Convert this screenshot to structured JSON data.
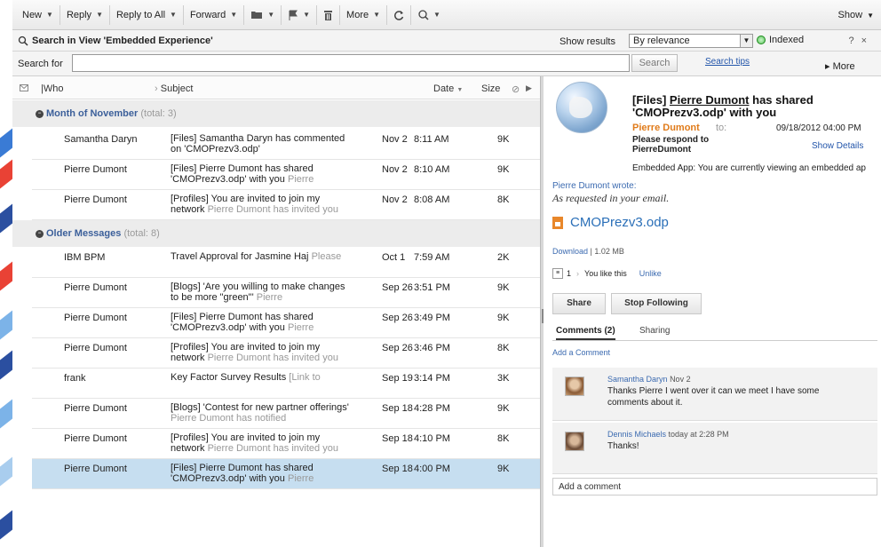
{
  "toolbar": {
    "new": "New",
    "reply": "Reply",
    "reply_all": "Reply to All",
    "forward": "Forward",
    "more": "More",
    "show": "Show"
  },
  "search_header": {
    "title": "Search in View 'Embedded Experience'",
    "show_results_label": "Show results",
    "sort_value": "By relevance",
    "indexed": "Indexed",
    "help": "?",
    "close": "×"
  },
  "search_row": {
    "label": "Search for",
    "value": "",
    "button": "Search",
    "tips": "Search tips",
    "more": "▸ More"
  },
  "columns": {
    "who": "Who",
    "subject": "Subject",
    "date": "Date",
    "size": "Size"
  },
  "groups": [
    {
      "name": "Month of November",
      "total": "(total: 3)"
    },
    {
      "name": "Older Messages",
      "total": "(total: 8)"
    }
  ],
  "messages": [
    {
      "who": "Samantha Daryn",
      "subject": "[Files] Samantha Daryn has commented on 'CMOPrezv3.odp'",
      "snippet": "",
      "date": "Nov 2",
      "time": "8:11 AM",
      "size": "9K"
    },
    {
      "who": "Pierre Dumont",
      "subject": "[Files] Pierre Dumont has shared 'CMOPrezv3.odp' with you",
      "snippet": "Pierre",
      "date": "Nov 2",
      "time": "8:10 AM",
      "size": "9K"
    },
    {
      "who": "Pierre Dumont",
      "subject": "[Profiles] You are invited to join my network",
      "snippet": "Pierre Dumont has invited you",
      "date": "Nov 2",
      "time": "8:08 AM",
      "size": "8K"
    },
    {
      "who": "IBM BPM",
      "subject": "Travel Approval for Jasmine Haj",
      "snippet": "Please",
      "date": "Oct 1",
      "time": "7:59 AM",
      "size": "2K"
    },
    {
      "who": "Pierre Dumont",
      "subject": "[Blogs] 'Are you willing to make changes to be more \"green\"'",
      "snippet": "Pierre",
      "date": "Sep 26",
      "time": "3:51 PM",
      "size": "9K"
    },
    {
      "who": "Pierre Dumont",
      "subject": "[Files] Pierre Dumont has shared 'CMOPrezv3.odp' with you",
      "snippet": "Pierre",
      "date": "Sep 26",
      "time": "3:49 PM",
      "size": "9K"
    },
    {
      "who": "Pierre Dumont",
      "subject": "[Profiles] You are invited to join my network",
      "snippet": "Pierre Dumont has invited you",
      "date": "Sep 26",
      "time": "3:46 PM",
      "size": "8K"
    },
    {
      "who": "frank",
      "subject": "Key Factor Survey Results",
      "snippet": "[Link to",
      "date": "Sep 19",
      "time": "3:14 PM",
      "size": "3K"
    },
    {
      "who": "Pierre Dumont",
      "subject": "[Blogs] 'Contest for new partner offerings'",
      "snippet": "Pierre Dumont has notified",
      "date": "Sep 18",
      "time": "4:28 PM",
      "size": "9K"
    },
    {
      "who": "Pierre Dumont",
      "subject": "[Profiles] You are invited to join my network",
      "snippet": "Pierre Dumont has invited you",
      "date": "Sep 18",
      "time": "4:10 PM",
      "size": "8K"
    },
    {
      "who": "Pierre Dumont",
      "subject": "[Files] Pierre Dumont has shared 'CMOPrezv3.odp' with you",
      "snippet": "Pierre",
      "date": "Sep 18",
      "time": "4:00 PM",
      "size": "9K"
    }
  ],
  "reader": {
    "title_prefix": "[Files]",
    "title_link": "Pierre Dumont",
    "title_rest": "has shared 'CMOPrezv3.odp' with you",
    "from": "Pierre Dumont",
    "to": "to:",
    "date": "09/18/2012 04:00 PM",
    "respond": "Please respond to PierreDumont",
    "show_details": "Show Details",
    "embedded_note": "Embedded App: You are currently viewing an embedded ap",
    "wrote": "Pierre Dumont wrote:",
    "body": "As requested in your email.",
    "file_name": "CMOPrezv3.odp",
    "download": "Download",
    "file_size": "1.02 MB",
    "like_count": "1",
    "like_text": "You like this",
    "unlike": "Unlike",
    "share": "Share",
    "stop_following": "Stop Following",
    "tab_comments": "Comments (2)",
    "tab_sharing": "Sharing",
    "add_comment_link": "Add a Comment",
    "comments": [
      {
        "name": "Samantha Daryn",
        "when": "Nov 2",
        "text": "Thanks Pierre I went over it can we meet I have some comments about it."
      },
      {
        "name": "Dennis Michaels",
        "when": "today at 2:28 PM",
        "text": "Thanks!"
      }
    ],
    "add_comment_placeholder": "Add a comment"
  }
}
